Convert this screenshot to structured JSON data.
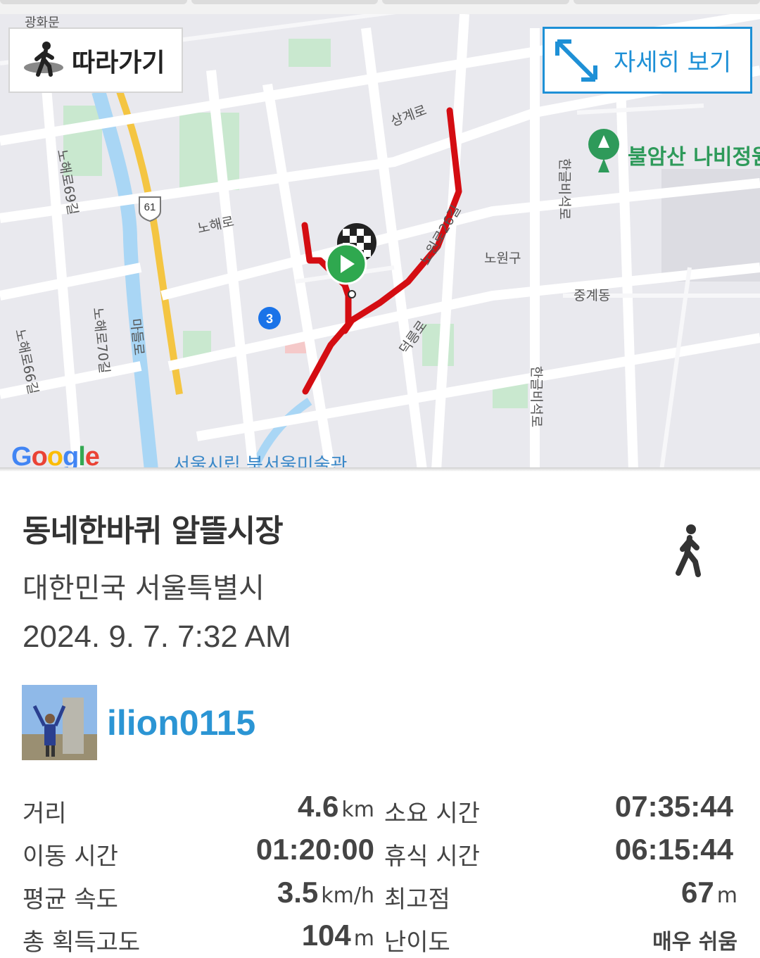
{
  "map": {
    "follow_button_label": "따라가기",
    "detail_button_label": "자세히 보기",
    "park_label": "불암산 나비정원",
    "road_labels": [
      "상계로",
      "노해로69길",
      "노해로",
      "노원로26길",
      "노원구",
      "중계동",
      "한글비석로",
      "노해로70길",
      "마들로",
      "노해로66길",
      "덕릉로",
      "한글비석로",
      "3",
      "61",
      "광화문"
    ],
    "bottom_label": "서울시립 북서울미술관",
    "google_logo": "Google",
    "route_color": "#d40d12",
    "accent_color": "#1e90d6"
  },
  "activity": {
    "title": "동네한바퀴 알뜰시장",
    "location": "대한민국 서울특별시",
    "datetime": "2024. 9. 7. 7:32 AM",
    "activity_icon": "hiker-icon",
    "username": "ilion0115"
  },
  "stats": {
    "distance_label": "거리",
    "distance_value": "4.6",
    "distance_unit": "km",
    "total_time_label": "소요 시간",
    "total_time_value": "07:35:44",
    "moving_time_label": "이동 시간",
    "moving_time_value": "01:20:00",
    "rest_time_label": "휴식 시간",
    "rest_time_value": "06:15:44",
    "avg_speed_label": "평균 속도",
    "avg_speed_value": "3.5",
    "avg_speed_unit": "km/h",
    "max_alt_label": "최고점",
    "max_alt_value": "67",
    "max_alt_unit": "m",
    "gain_label": "총 획득고도",
    "gain_value": "104",
    "gain_unit": "m",
    "difficulty_label": "난이도",
    "difficulty_value": "매우 쉬움"
  }
}
